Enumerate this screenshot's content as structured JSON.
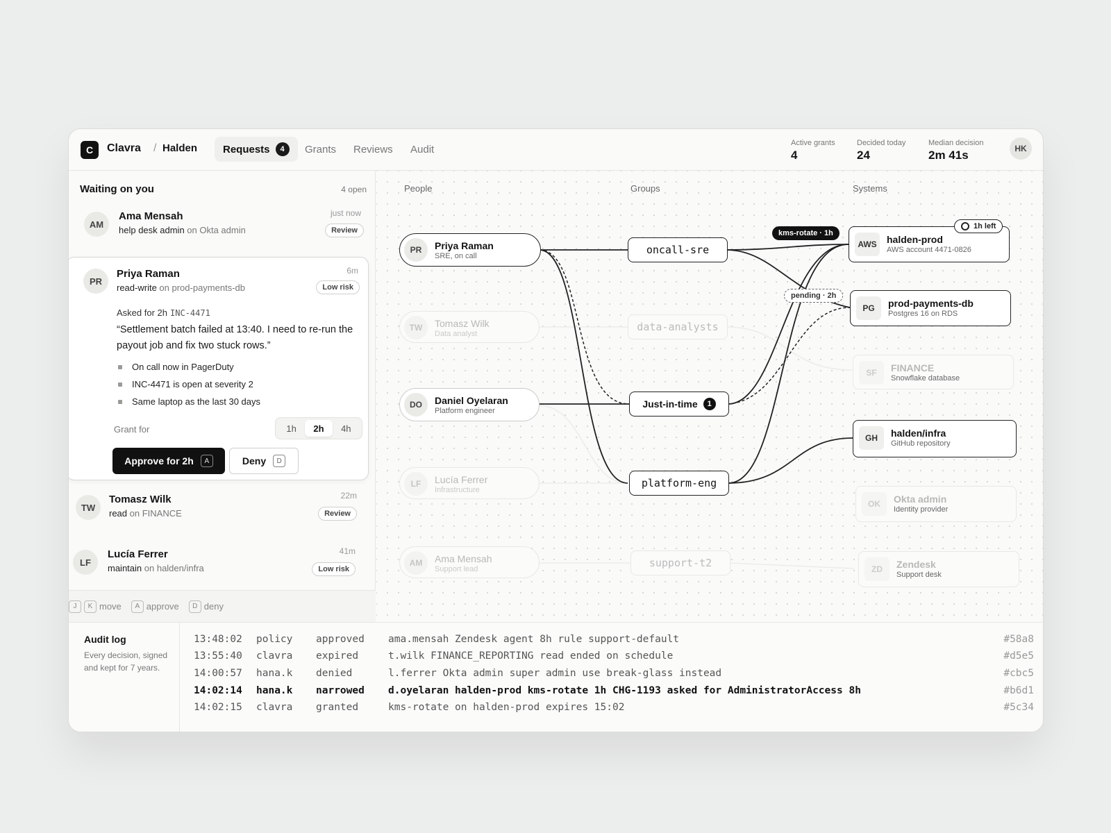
{
  "app": {
    "logo": "C",
    "name": "Clavra",
    "separator": "/",
    "workspace": "Halden"
  },
  "nav": {
    "tabs": [
      {
        "label": "Requests",
        "count": "4"
      },
      {
        "label": "Grants"
      },
      {
        "label": "Reviews"
      },
      {
        "label": "Audit"
      }
    ]
  },
  "stats": [
    {
      "label": "Active grants",
      "value": "4"
    },
    {
      "label": "Decided today",
      "value": "24"
    },
    {
      "label": "Median decision",
      "value": "2m 41s"
    }
  ],
  "user": {
    "initials": "HK"
  },
  "queue": {
    "title": "Waiting on you",
    "open": "4 open",
    "items": [
      {
        "initials": "AM",
        "name": "Ama Mensah",
        "access": "help desk admin",
        "on": "on Okta admin",
        "time": "just now",
        "pill": "Review"
      },
      {
        "initials": "PR",
        "name": "Priya Raman",
        "access": "read-write",
        "on": "on prod-payments-db",
        "time": "6m",
        "pill": "Low risk"
      },
      {
        "initials": "TW",
        "name": "Tomasz Wilk",
        "access": "read",
        "on": "on FINANCE",
        "time": "22m",
        "pill": "Review"
      },
      {
        "initials": "LF",
        "name": "Lucía Ferrer",
        "access": "maintain",
        "on": "on halden/infra",
        "time": "41m",
        "pill": "Low risk"
      }
    ],
    "detail": {
      "asked": "Asked for 2h",
      "ticket": "INC-4471",
      "quote": "“Settlement batch failed at 13:40. I need to re-run the payout job and fix two stuck rows.”",
      "signals": [
        "On call now in PagerDuty",
        "INC-4471 is open at severity 2",
        "Same laptop as the last 30 days"
      ],
      "grant_label": "Grant for",
      "durations": [
        "1h",
        "2h",
        "4h"
      ],
      "selected_duration": "2h",
      "approve_label": "Approve for 2h",
      "approve_key": "A",
      "deny_label": "Deny",
      "deny_key": "D"
    },
    "hints": {
      "move_keys": [
        "J",
        "K"
      ],
      "move": "move",
      "approve_key": "A",
      "approve": "approve",
      "deny_key": "D",
      "deny": "deny"
    }
  },
  "graph": {
    "columns": [
      "People",
      "Groups",
      "Systems"
    ],
    "people": [
      {
        "initials": "PR",
        "name": "Priya Raman",
        "role": "SRE, on call",
        "active": true
      },
      {
        "initials": "TW",
        "name": "Tomasz Wilk",
        "role": "Data analyst",
        "active": false
      },
      {
        "initials": "DO",
        "name": "Daniel Oyelaran",
        "role": "Platform engineer",
        "active": true
      },
      {
        "initials": "LF",
        "name": "Lucía Ferrer",
        "role": "Infrastructure",
        "active": false
      },
      {
        "initials": "AM",
        "name": "Ama Mensah",
        "role": "Support lead",
        "active": false
      }
    ],
    "groups": [
      {
        "name": "oncall-sre",
        "active": true
      },
      {
        "name": "data-analysts",
        "active": false
      },
      {
        "name": "Just-in-time",
        "badge": "1",
        "active": true
      },
      {
        "name": "platform-eng",
        "active": true
      },
      {
        "name": "support-t2",
        "active": false
      }
    ],
    "systems": [
      {
        "icon": "AWS",
        "name": "halden-prod",
        "desc": "AWS account 4471-0826",
        "active": true
      },
      {
        "icon": "PG",
        "name": "prod-payments-db",
        "desc": "Postgres 16 on RDS",
        "active": true
      },
      {
        "icon": "SF",
        "name": "FINANCE",
        "desc": "Snowflake database",
        "active": false
      },
      {
        "icon": "GH",
        "name": "halden/infra",
        "desc": "GitHub repository",
        "active": true
      },
      {
        "icon": "OK",
        "name": "Okta admin",
        "desc": "Identity provider",
        "active": false
      },
      {
        "icon": "ZD",
        "name": "Zendesk",
        "desc": "Support desk",
        "active": false
      }
    ],
    "tags": {
      "kms": "kms-rotate · 1h",
      "pending": "pending · 2h",
      "left": "1h left"
    }
  },
  "audit": {
    "title": "Audit log",
    "desc": "Every decision, signed and kept for 7 years.",
    "rows": [
      {
        "time": "13:48:02",
        "actor": "policy",
        "action": "approved",
        "detail": "ama.mensah Zendesk agent 8h rule support-default",
        "hash": "#58a8"
      },
      {
        "time": "13:55:40",
        "actor": "clavra",
        "action": "expired",
        "detail": "t.wilk FINANCE_REPORTING read ended on schedule",
        "hash": "#d5e5"
      },
      {
        "time": "14:00:57",
        "actor": "hana.k",
        "action": "denied",
        "detail": "l.ferrer Okta admin super admin use break-glass instead",
        "hash": "#cbc5"
      },
      {
        "time": "14:02:14",
        "actor": "hana.k",
        "action": "narrowed",
        "detail": "d.oyelaran halden-prod kms-rotate 1h CHG-1193 asked for AdministratorAccess 8h",
        "hash": "#b6d1"
      },
      {
        "time": "14:02:15",
        "actor": "clavra",
        "action": "granted",
        "detail": "kms-rotate on halden-prod expires 15:02",
        "hash": "#5c34"
      }
    ]
  }
}
